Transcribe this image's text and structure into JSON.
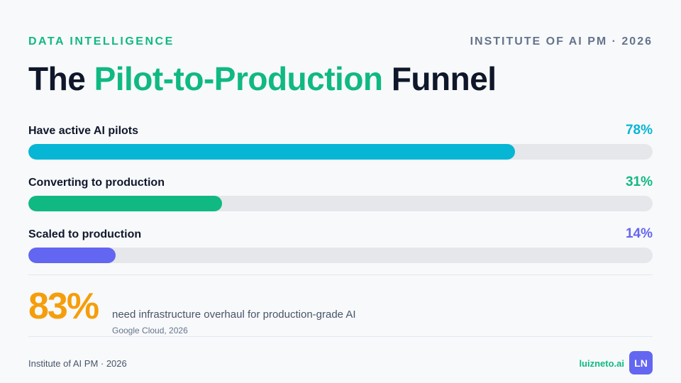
{
  "header": {
    "eyebrow": "DATA INTELLIGENCE",
    "institute": "INSTITUTE OF AI PM · 2026",
    "title_pre": "The ",
    "title_highlight": "Pilot-to-Production",
    "title_post": " Funnel"
  },
  "colors": {
    "accent_green": "#10b981",
    "cyan": "#06b6d4",
    "indigo": "#6366f1",
    "amber": "#f59e0b",
    "track": "#e5e7eb"
  },
  "bars": [
    {
      "label": "Have active AI pilots",
      "value_text": "78%",
      "value": 78,
      "color": "#06b6d4"
    },
    {
      "label": "Converting to production",
      "value_text": "31%",
      "value": 31,
      "color": "#10b981"
    },
    {
      "label": "Scaled to production",
      "value_text": "14%",
      "value": 14,
      "color": "#6366f1"
    }
  ],
  "stat": {
    "value": "83%",
    "text": "need infrastructure overhaul for production-grade AI",
    "source": "Google Cloud, 2026"
  },
  "footer": {
    "left": "Institute of AI PM · 2026",
    "brand": "luizneto.ai",
    "badge": "LN"
  }
}
